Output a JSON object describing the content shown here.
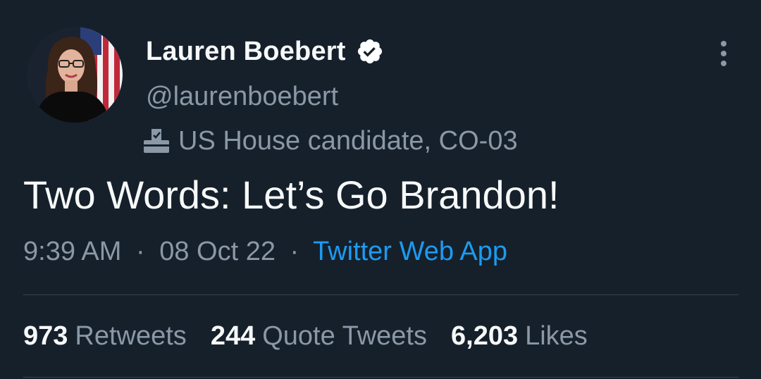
{
  "tweet": {
    "author": {
      "display_name": "Lauren Boebert",
      "handle": "@laurenboebert",
      "verified": true,
      "label": "US House candidate, CO-03",
      "label_icon": "ballot-box-icon"
    },
    "text": "Two Words: Let’s Go Brandon!",
    "meta": {
      "time": "9:39 AM",
      "separator": "·",
      "date": "08 Oct 22",
      "source": "Twitter Web App"
    },
    "stats": [
      {
        "count": "973",
        "label": "Retweets"
      },
      {
        "count": "244",
        "label": "Quote Tweets"
      },
      {
        "count": "6,203",
        "label": "Likes"
      }
    ]
  },
  "colors": {
    "background": "#15202b",
    "primary_text": "#f7f9f9",
    "secondary_text": "#8b98a5",
    "link": "#1d9bf0",
    "divider": "#38444d"
  }
}
